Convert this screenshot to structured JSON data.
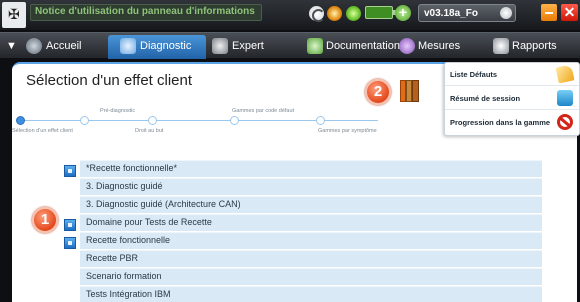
{
  "topbar": {
    "logo_icon": "peugeot-logo-icon",
    "marquee_text": "Notice d'utilisation du panneau d'informations",
    "version": "v03.18a_Fo"
  },
  "nav": {
    "tabs": [
      {
        "label": "Accueil",
        "icon": "home-icon"
      },
      {
        "label": "Diagnostic",
        "icon": "diagnostic-icon",
        "active": true
      },
      {
        "label": "Expert",
        "icon": "expert-icon"
      },
      {
        "label": "Documentation",
        "icon": "documentation-icon"
      },
      {
        "label": "Mesures",
        "icon": "measures-icon"
      },
      {
        "label": "Rapports",
        "icon": "reports-icon"
      }
    ]
  },
  "panel": {
    "title": "Sélection d'un effet client"
  },
  "steps": {
    "top_labels": [
      "Pré-diagnostic",
      "Gammes par code défaut"
    ],
    "bottom_labels": [
      "Sélection d'un effet client",
      "Droit au but",
      "Gammes par symptôme"
    ]
  },
  "callouts": {
    "one": "1",
    "two": "2"
  },
  "menu": {
    "items": [
      {
        "label": "Liste Défauts",
        "icon": "pencil-icon"
      },
      {
        "label": "Résumé de session",
        "icon": "folder-icon"
      },
      {
        "label": "Progression dans la gamme",
        "icon": "no-entry-icon"
      }
    ]
  },
  "list": {
    "rows": [
      "*Recette fonctionnelle*",
      "3. Diagnostic guidé",
      "3. Diagnostic guidé (Architecture CAN)",
      "Domaine pour Tests de Recette",
      "Recette fonctionnelle",
      "Recette PBR",
      "Scenario formation",
      "Tests Intégration IBM"
    ],
    "rows_with_icon": [
      0,
      3,
      4
    ]
  },
  "colors": {
    "accent": "#3f8fe0",
    "row_bg": "#d9e9f6",
    "callout": "#e4481c"
  }
}
